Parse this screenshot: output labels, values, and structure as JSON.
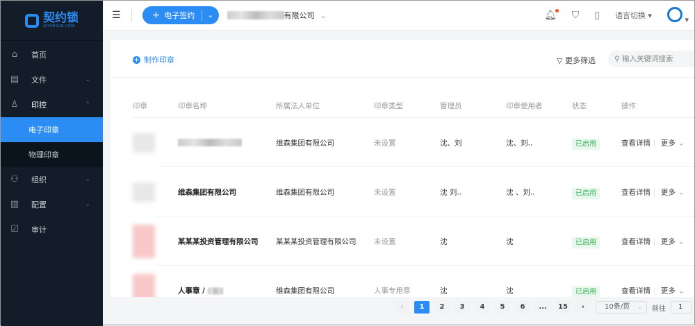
{
  "brand": {
    "name": "契约锁",
    "domain": "QIYUESUO.COM"
  },
  "sidebar": {
    "items": [
      {
        "label": "首页",
        "icon": "home-icon"
      },
      {
        "label": "文件",
        "icon": "file-icon"
      },
      {
        "label": "印控",
        "icon": "seal-icon",
        "sub": [
          "电子印章",
          "物理印章"
        ]
      },
      {
        "label": "组织",
        "icon": "org-icon"
      },
      {
        "label": "配置",
        "icon": "config-icon"
      },
      {
        "label": "审计",
        "icon": "audit-icon"
      }
    ]
  },
  "topbar": {
    "sign_label": "电子签约",
    "company_suffix": "有限公司",
    "lang": "语言切换"
  },
  "toolbar": {
    "make_seal": "制作印章",
    "more_filter": "更多筛选",
    "search_placeholder": "输入关键词搜索"
  },
  "table": {
    "headers": [
      "印章",
      "印章名称",
      "所属法人单位",
      "印章类型",
      "管理员",
      "印章使用者",
      "状态",
      "操作"
    ],
    "rows": [
      {
        "name": "",
        "unit": "维森集团有限公司",
        "type": "未设置",
        "admin": "沈、刘",
        "users": "沈、刘..",
        "status": "已启用"
      },
      {
        "name": "维森集团有限公司",
        "unit": "维森集团有限公司",
        "type": "未设置",
        "admin": "沈  刘..",
        "users": "沈  、刘..",
        "status": "已启用"
      },
      {
        "name": "某某某投资管理有限公司",
        "unit": "某某某投资管理有限公司",
        "type": "未设置",
        "admin": "沈",
        "users": "沈",
        "status": "已启用"
      },
      {
        "name": "人事章 / ",
        "unit": "维森集团有限公司",
        "type": "人事专用章",
        "admin": "沈",
        "users": "沈",
        "status": "已启用"
      }
    ],
    "view": "查看详情",
    "more": "更多"
  },
  "pagination": {
    "pages": [
      "1",
      "2",
      "3",
      "4",
      "5",
      "6",
      "...",
      "15"
    ],
    "current": "1",
    "page_size": "10条/页",
    "goto_label": "前往",
    "goto_value": "1"
  }
}
